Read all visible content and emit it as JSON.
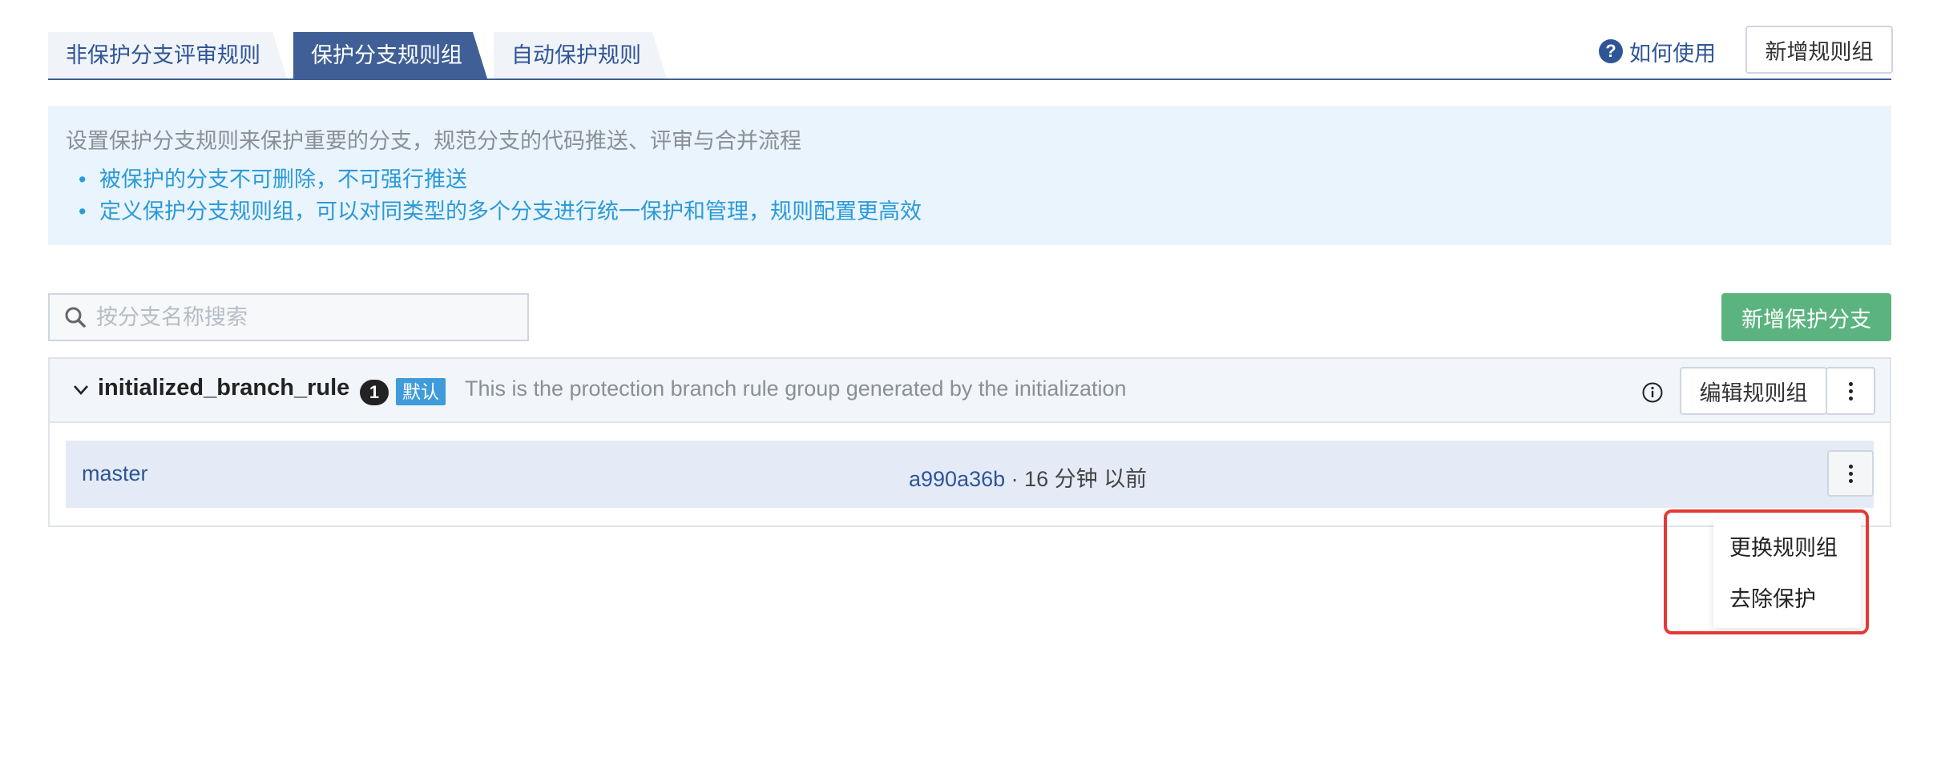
{
  "tabs": [
    {
      "label": "非保护分支评审规则"
    },
    {
      "label": "保护分支规则组"
    },
    {
      "label": "自动保护规则"
    }
  ],
  "header": {
    "help_label": "如何使用",
    "new_group_label": "新增规则组"
  },
  "info": {
    "title": "设置保护分支规则来保护重要的分支，规范分支的代码推送、评审与合并流程",
    "bullets": [
      "被保护的分支不可删除，不可强行推送",
      "定义保护分支规则组，可以对同类型的多个分支进行统一保护和管理，规则配置更高效"
    ]
  },
  "search": {
    "placeholder": "按分支名称搜索"
  },
  "new_branch_label": "新增保护分支",
  "rule_group": {
    "name": "initialized_branch_rule",
    "count": "1",
    "default_badge": "默认",
    "description": "This is the protection branch rule group generated by the initialization",
    "edit_label": "编辑规则组",
    "branches": [
      {
        "name": "master",
        "commit": "a990a36b",
        "time": "· 16 分钟 以前"
      }
    ]
  },
  "menu": {
    "items": [
      "更换规则组",
      "去除保护"
    ]
  },
  "colors": {
    "accent": "#3f5f96",
    "link": "#2f5597",
    "green": "#5bb47f",
    "highlight": "#e53935"
  }
}
